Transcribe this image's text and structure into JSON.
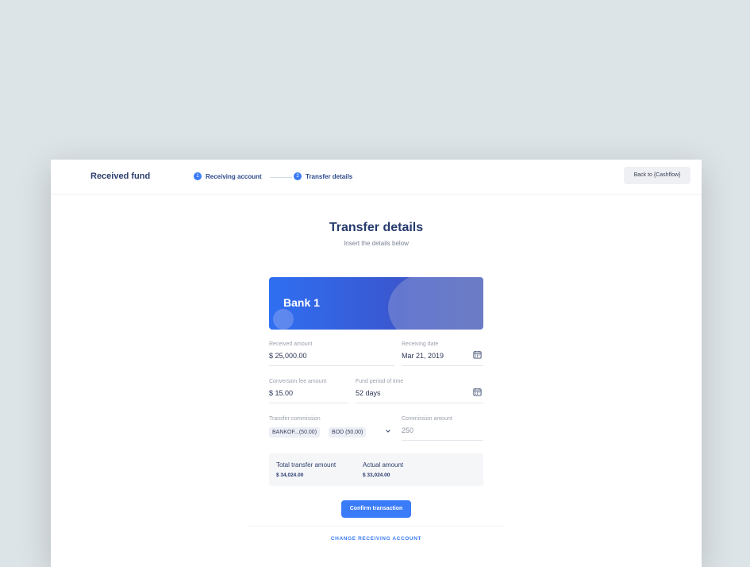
{
  "header": {
    "app_title": "Received fund",
    "steps": [
      {
        "number": "1",
        "label": "Receiving account"
      },
      {
        "number": "2",
        "label": "Transfer details"
      }
    ],
    "back_button": "Back to {Cashflow}"
  },
  "main": {
    "title": "Transfer details",
    "subtitle": "Insert the details below"
  },
  "card": {
    "bank_name": "Bank 1"
  },
  "form": {
    "received_amount": {
      "label": "Received amount",
      "value": "$ 25,000.00"
    },
    "receiving_date": {
      "label": "Receiving date",
      "value": "Mar 21, 2019",
      "icon": "calendar-icon"
    },
    "conversion_fee": {
      "label": "Conversion fee amount",
      "value": "$ 15.00"
    },
    "fund_period": {
      "label": "Fund period of time",
      "value": "52 days",
      "icon": "calendar-icon"
    },
    "transfer_commission": {
      "label": "Transfer commission",
      "chips": [
        "BANKOF...(50.00)",
        "BOD (50.00)"
      ],
      "icon": "chevron-down-icon"
    },
    "commission_amount": {
      "label": "Commission amount",
      "value": "250"
    }
  },
  "totals": {
    "total_label": "Total transfer amount",
    "total_value": "$ 34,024.00",
    "actual_label": "Actual amount",
    "actual_value": "$ 33,024.00"
  },
  "actions": {
    "confirm": "Confirm transaction",
    "change_account": "CHANGE RECEIVING ACCOUNT"
  },
  "colors": {
    "accent": "#3a7bf7",
    "navy": "#263a6e",
    "background": "#dde4e7"
  }
}
